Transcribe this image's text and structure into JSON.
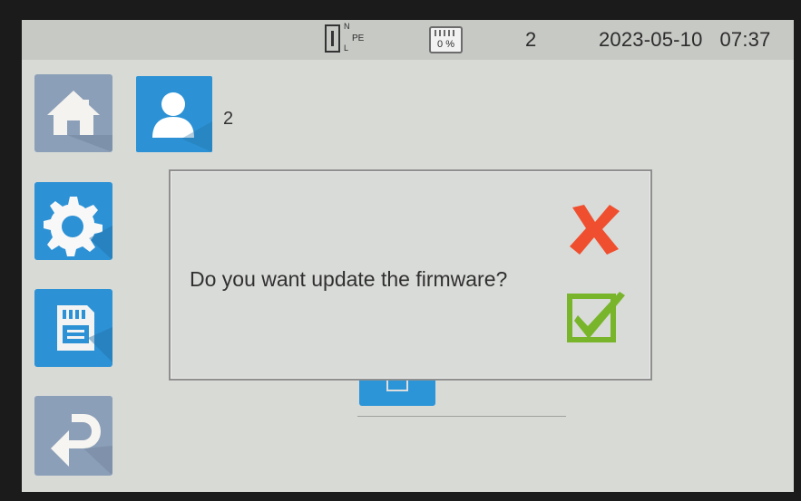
{
  "status_bar": {
    "socket_n": "N",
    "socket_pe": "PE",
    "socket_l": "L",
    "memory_usage": "0 %",
    "count": "2",
    "date": "2023-05-10",
    "time": "07:37"
  },
  "sidebar": [
    {
      "icon": "home-icon"
    },
    {
      "icon": "gear-icon"
    },
    {
      "icon": "sd-card-icon"
    },
    {
      "icon": "back-arrow-icon"
    }
  ],
  "user": {
    "icon": "user-icon",
    "number": "2"
  },
  "dialog": {
    "message": "Do you want update the firmware?",
    "cancel_icon": "red-x-icon",
    "confirm_icon": "green-check-icon"
  },
  "colors": {
    "accent_blue": "#2c92d5",
    "muted_blue": "#8c9fb8",
    "cancel_red": "#ef4f2f",
    "confirm_green": "#78b52b"
  }
}
